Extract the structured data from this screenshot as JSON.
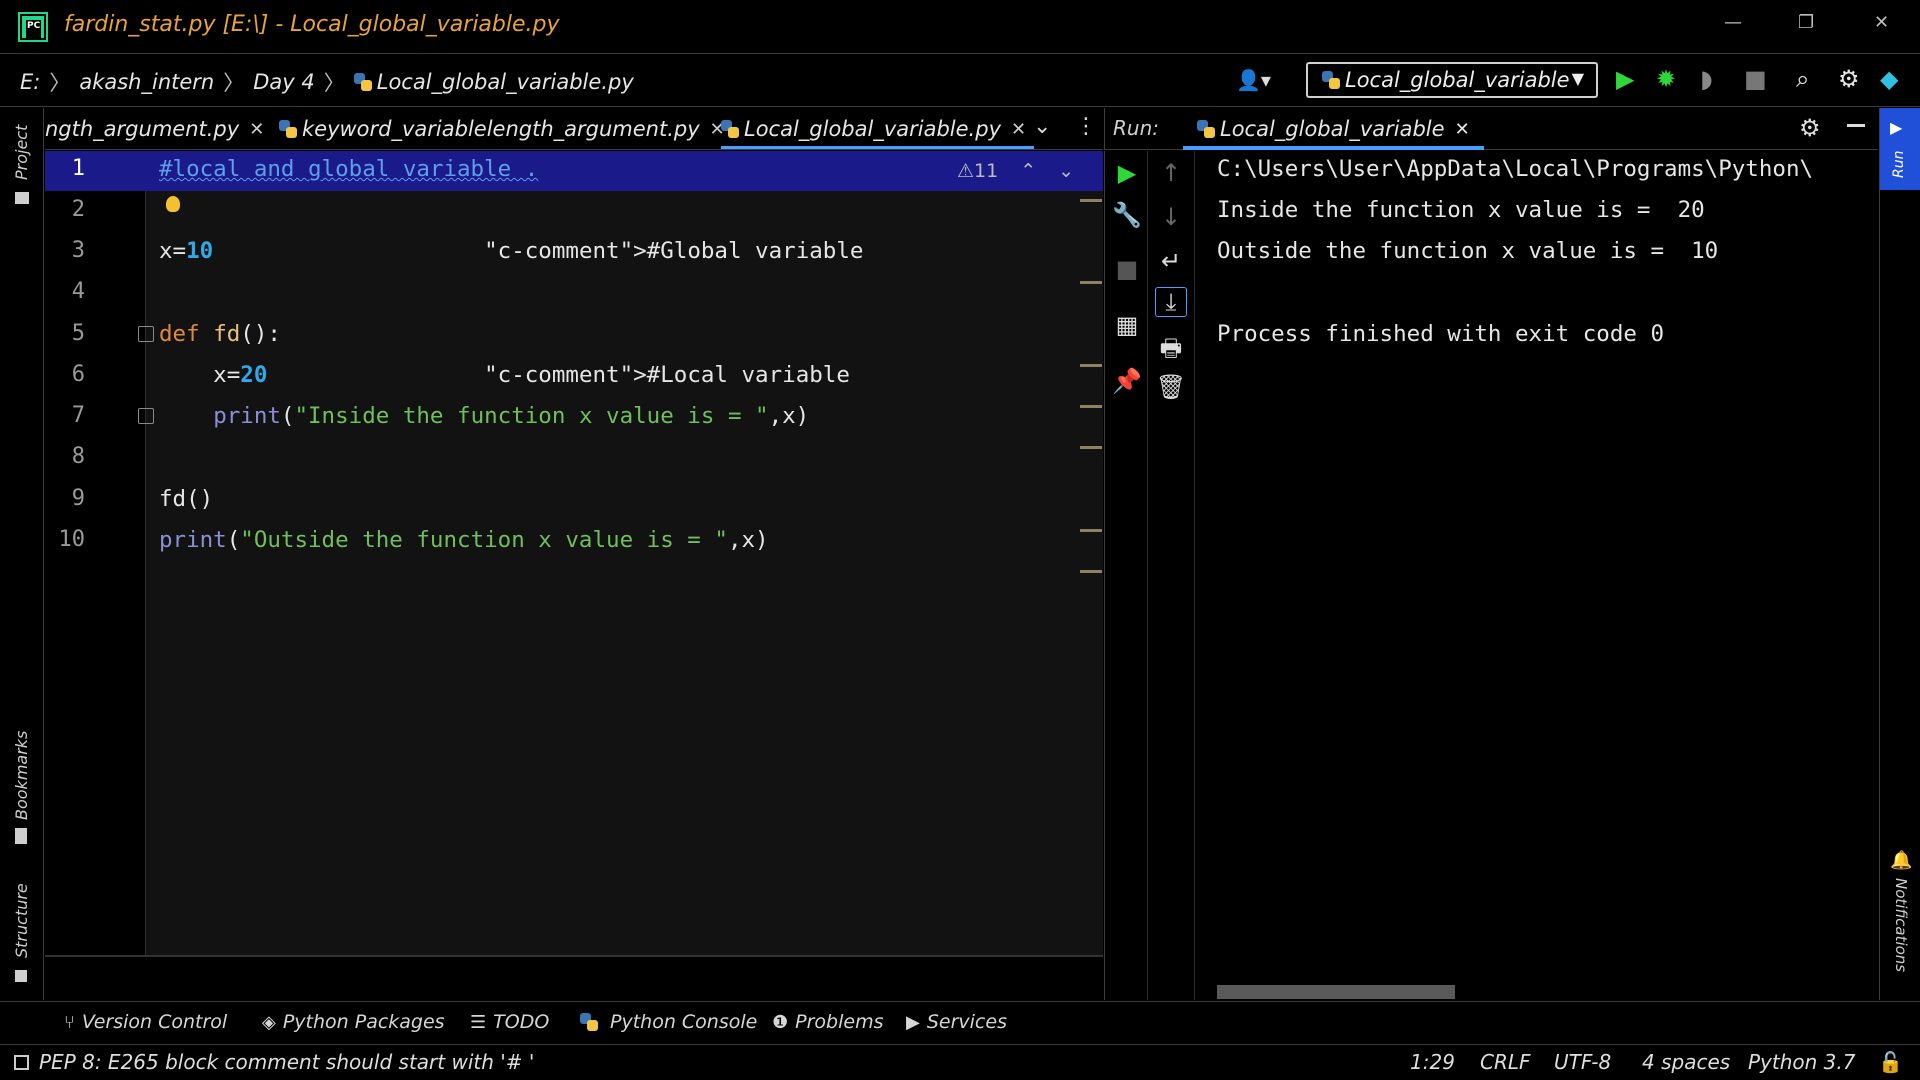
{
  "window": {
    "title": "fardin_stat.py [E:\\] - Local_global_variable.py",
    "minimize": "—",
    "restore": "❐",
    "close": "✕"
  },
  "breadcrumb": [
    "E:",
    "akash_intern",
    "Day 4",
    "Local_global_variable.py"
  ],
  "toolbar": {
    "run_config": "Local_global_variable"
  },
  "editor_tabs": [
    {
      "label": "ngth_argument.py",
      "active": false
    },
    {
      "label": "keyword_variablelength_argument.py",
      "active": false
    },
    {
      "label": "Local_global_variable.py",
      "active": true
    }
  ],
  "editor": {
    "warnings_count": "11",
    "lines": [
      {
        "n": "1",
        "text": "#local and global variable ."
      },
      {
        "n": "2",
        "text": ""
      },
      {
        "n": "3",
        "text": "x=10                    #Global variable"
      },
      {
        "n": "4",
        "text": ""
      },
      {
        "n": "5",
        "text": "def fd():"
      },
      {
        "n": "6",
        "text": "    x=20                #Local variable"
      },
      {
        "n": "7",
        "text": "    print(\"Inside the function x value is = \",x)"
      },
      {
        "n": "8",
        "text": ""
      },
      {
        "n": "9",
        "text": "fd()"
      },
      {
        "n": "10",
        "text": "print(\"Outside the function x value is = \",x)"
      }
    ]
  },
  "run_panel": {
    "label": "Run:",
    "tab": "Local_global_variable",
    "output": [
      "C:\\Users\\User\\AppData\\Local\\Programs\\Python\\",
      "Inside the function x value is =  20",
      "Outside the function x value is =  10",
      "",
      "Process finished with exit code 0"
    ]
  },
  "left_strip": {
    "project": "Project",
    "bookmarks": "Bookmarks",
    "structure": "Structure"
  },
  "right_strip": {
    "run": "Run",
    "notifications": "Notifications"
  },
  "bottom_tools": [
    "Version Control",
    "Python Packages",
    "TODO",
    "Python Console",
    "Problems",
    "Services"
  ],
  "status": {
    "message": "PEP 8: E265 block comment should start with '# '",
    "position": "1:29",
    "line_sep": "CRLF",
    "encoding": "UTF-8",
    "indent": "4 spaces",
    "interpreter": "Python 3.7"
  },
  "colors": {
    "accent": "#4a9eff",
    "current_line": "#1a1a8a",
    "title": "#e8a33a",
    "run_green": "#2fd73a"
  }
}
